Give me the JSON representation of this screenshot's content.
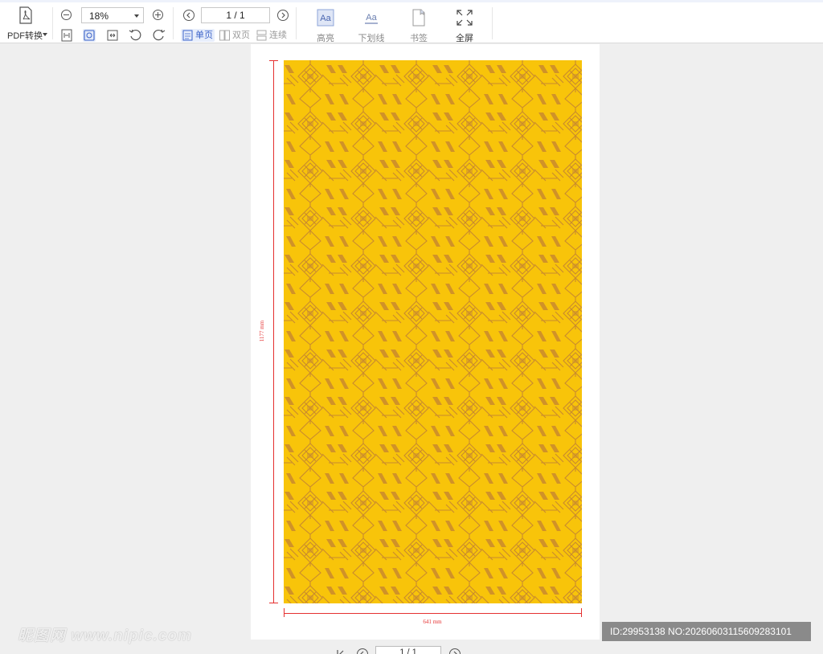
{
  "toolbar": {
    "pdf_convert_label": "PDF转换",
    "zoom_value": "18%",
    "page_value": "1 / 1",
    "view_modes": {
      "single": "单页",
      "double": "双页",
      "continuous": "连续"
    },
    "tools": {
      "highlight": "高亮",
      "underline": "下划线",
      "bookmark": "书签",
      "fullscreen": "全屏"
    }
  },
  "document": {
    "height_dimension": "1177 mm",
    "width_dimension": "641 mm",
    "pattern_colors": {
      "background": "#f8c40a",
      "motif": "#c98a2e"
    }
  },
  "bottom_bar": {
    "page_value": "1 / 1"
  },
  "watermark": {
    "site": "昵图网 www.nipic.com",
    "id_text": "ID:29953138 NO:20260603115609283101"
  }
}
